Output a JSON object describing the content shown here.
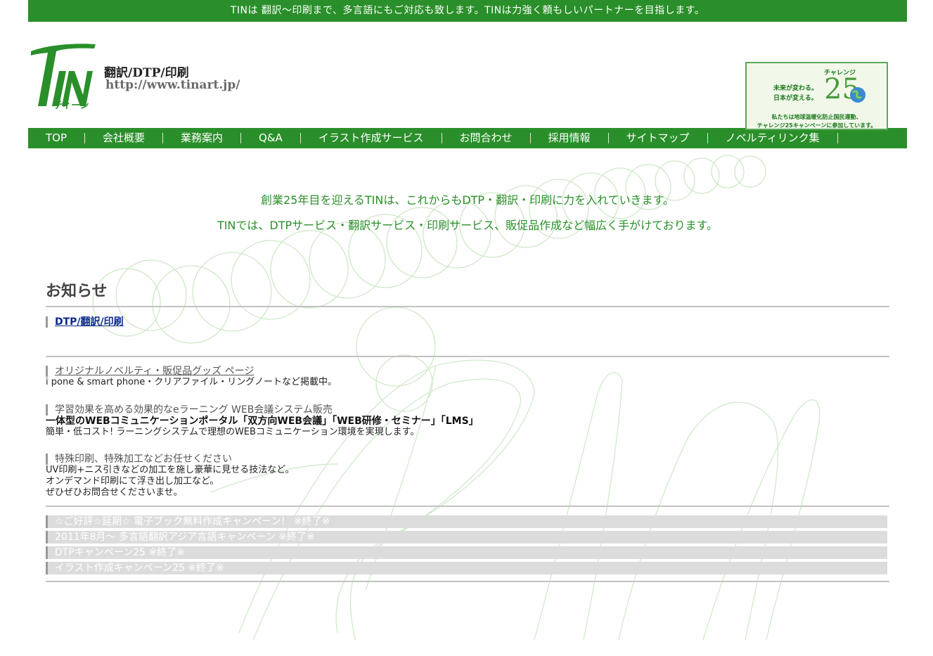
{
  "top_bar": {
    "text": "TINは 翻訳〜印刷まで、多言語にもご対応も致します。TINは力強く頼もしいパートナーを目指します。"
  },
  "logo": {
    "mark_text": "TIN",
    "kana": "ティーン",
    "tagline": "翻訳/DTP/印刷",
    "url_text": "http://www.tinart.jp/"
  },
  "challenge_badge": {
    "label": "チャレンジ",
    "number": "25",
    "line1": "未来が変わる。",
    "line2": "日本が変える。",
    "foot1": "私たちは地球温暖化防止国民運動、",
    "foot2": "チャレンジ25キャンペーンに参加しています。"
  },
  "nav": [
    "TOP",
    "会社概要",
    "業務案内",
    "Q&A",
    "イラスト作成サービス",
    "お問合わせ",
    "採用情報",
    "サイトマップ",
    "ノベルティリンク集"
  ],
  "intro": {
    "line1": "創業25年目を迎えるTINは、これからもDTP・翻訳・印刷に力を入れていきます。",
    "line2": "TINでは、DTPサービス・翻訳サービス・印刷サービス、販促品作成など幅広く手がけております。"
  },
  "news": {
    "title": "お知らせ",
    "dtp_link": "DTP/翻訳/印刷",
    "novelty": {
      "head": "オリジナルノベルティ・販促品グッズ ページ",
      "desc": "i pone & smart phone・クリアファイル・リングノートなど掲載中。"
    },
    "elearning": {
      "head": "学習効果を高める効果的なeラーニング WEB会議システム販売",
      "line1": "一体型のWEBコミュニケーションポータル「双方向WEB会議」「WEB研修・セミナー」「LMS」",
      "line2": "簡単・低コスト! ラーニングシステムで理想のWEBコミュニケーション環境を実現します。"
    },
    "special": {
      "head": "特殊印刷、特殊加工などお任せください",
      "line1": "UV印刷+ニス引きなどの加工を施し豪華に見せる技法など。",
      "line2": "オンデマンド印刷にて浮き出し加工など。",
      "line3": "ぜひぜひお問合せくださいませ。"
    },
    "campaigns": [
      "☆ご好評☆延期☆ 電子ブック無料作成キャンペーン！ ※終了※",
      "2011年8月〜 多言語翻訳アジア言語キャンペーン ※終了※",
      "DTPキャンペーン25 ※終了※",
      "イラスト作成キャンペーン25 ※終了※"
    ]
  },
  "colors": {
    "brand_green": "#2a8f2a",
    "nav_text": "#ffffff",
    "link_blue": "#0a2a8a",
    "campaign_bg": "#dcdcdc"
  }
}
